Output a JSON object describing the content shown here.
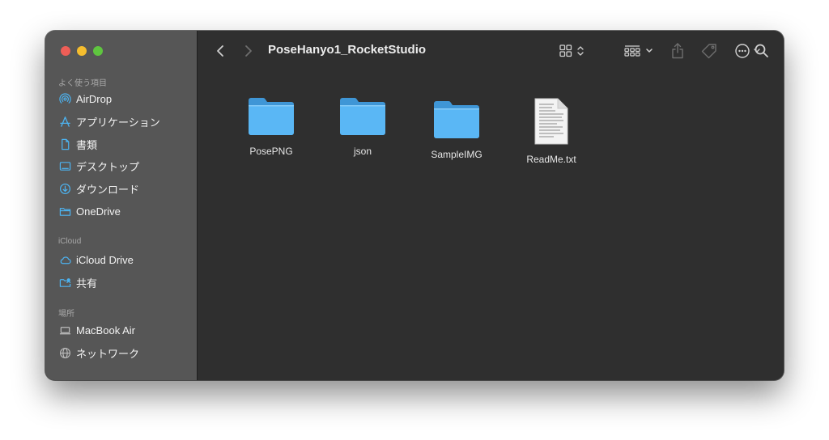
{
  "window": {
    "title": "PoseHanyo1_RocketStudio"
  },
  "sidebar": {
    "favorites_header": "よく使う項目",
    "favorites": [
      {
        "label": "AirDrop",
        "icon": "airdrop-icon"
      },
      {
        "label": "アプリケーション",
        "icon": "applications-icon"
      },
      {
        "label": "書類",
        "icon": "document-icon"
      },
      {
        "label": "デスクトップ",
        "icon": "desktop-icon"
      },
      {
        "label": "ダウンロード",
        "icon": "download-icon"
      },
      {
        "label": "OneDrive",
        "icon": "folder-icon"
      }
    ],
    "icloud_header": "iCloud",
    "icloud": [
      {
        "label": "iCloud Drive",
        "icon": "cloud-icon"
      },
      {
        "label": "共有",
        "icon": "shared-folder-icon"
      }
    ],
    "locations_header": "場所",
    "locations": [
      {
        "label": "MacBook Air",
        "icon": "laptop-icon"
      },
      {
        "label": "ネットワーク",
        "icon": "network-icon"
      }
    ]
  },
  "files": [
    {
      "name": "PosePNG",
      "type": "folder"
    },
    {
      "name": "json",
      "type": "folder"
    },
    {
      "name": "SampleIMG",
      "type": "folder"
    },
    {
      "name": "ReadMe.txt",
      "type": "text-document"
    }
  ],
  "colors": {
    "accent": "#4db3f0",
    "folder": "#5ab7f5",
    "sidebar_bg": "#565656",
    "content_bg": "#2f2f2f"
  }
}
